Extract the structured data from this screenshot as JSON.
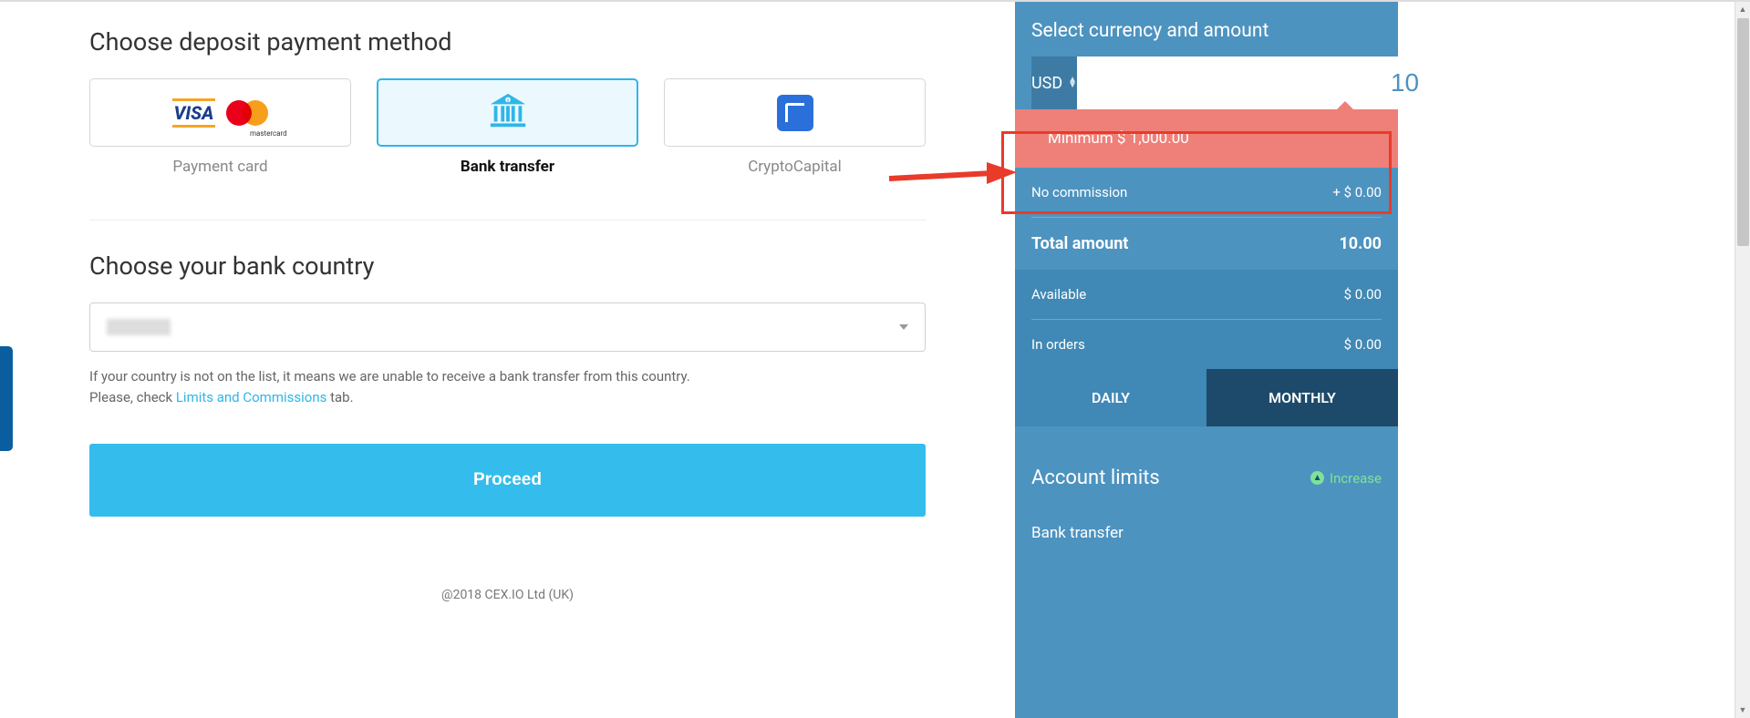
{
  "main": {
    "heading": "Choose deposit payment method",
    "methods": [
      {
        "label": "Payment card"
      },
      {
        "label": "Bank transfer"
      },
      {
        "label": "CryptoCapital"
      }
    ],
    "bank_heading": "Choose your bank country",
    "help_line1": "If your country is not on the list, it means we are unable to receive a bank transfer from this country.",
    "help_line2a": "Please, check ",
    "help_link": "Limits and Commissions",
    "help_line2b": " tab.",
    "proceed": "Proceed",
    "footer": "@2018 CEX.IO Ltd (UK)"
  },
  "side": {
    "title": "Select currency and amount",
    "currency": "USD",
    "amount": "10",
    "warning": "Minimum $ 1,000.00",
    "commission_label": "No commission",
    "commission_value": "+ $ 0.00",
    "total_label": "Total amount",
    "total_value": "10.00",
    "available_label": "Available",
    "available_value": "$ 0.00",
    "inorders_label": "In orders",
    "inorders_value": "$ 0.00",
    "tab_daily": "DAILY",
    "tab_monthly": "MONTHLY",
    "limits_title": "Account limits",
    "increase": "Increase",
    "limits_sub": "Bank transfer"
  }
}
